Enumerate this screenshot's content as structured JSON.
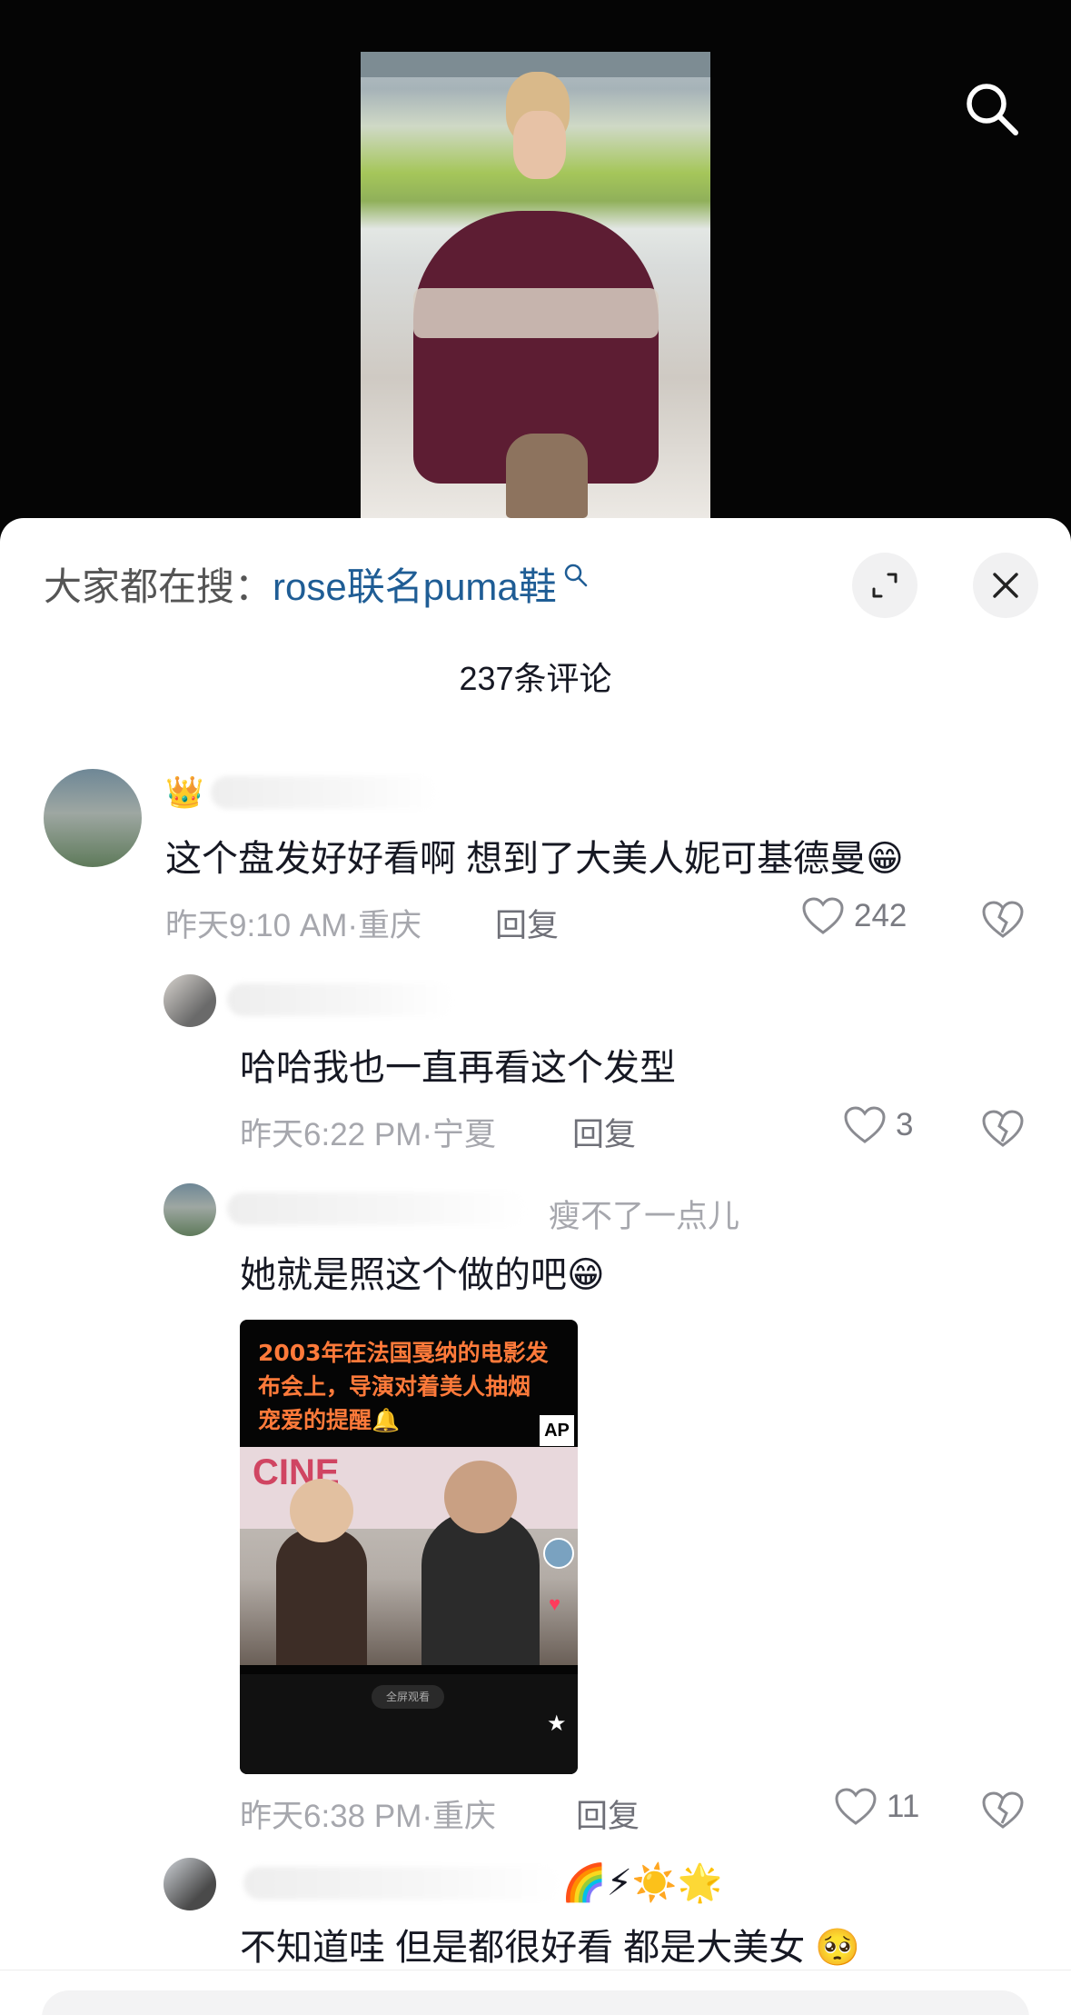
{
  "trending": {
    "prefix": "大家都在搜：",
    "query": "rose联名puma鞋"
  },
  "comments_header": {
    "count_label": "237条评论"
  },
  "comments": [
    {
      "badge": "👑",
      "text": "这个盘发好好看啊  想到了大美人妮可基德曼😁",
      "meta": "昨天9:10 AM·重庆",
      "reply_label": "回复",
      "likes": "242"
    },
    {
      "text": "哈哈我也一直再看这个发型",
      "meta": "昨天6:22 PM·宁夏",
      "reply_label": "回复",
      "likes": "3"
    },
    {
      "reply_to": "瘦不了一点儿",
      "text": "她就是照这个做的吧😁",
      "attached_video": {
        "caption": "2003年在法国戛纳的电影发布会上，导演对着美人抽烟宠爱的提醒🔔",
        "ap_badge": "AP",
        "banner": "CINE",
        "pill": "全屏观看"
      },
      "meta": "昨天6:38 PM·重庆",
      "reply_label": "回复",
      "likes": "11"
    },
    {
      "badges": "🌈⚡☀️🌟",
      "text": "不知道哇 但是都很好看 都是大美女 🥺"
    }
  ],
  "colors": {
    "link": "#1f5d95",
    "meta": "#a6a7ad",
    "text": "#161823"
  }
}
